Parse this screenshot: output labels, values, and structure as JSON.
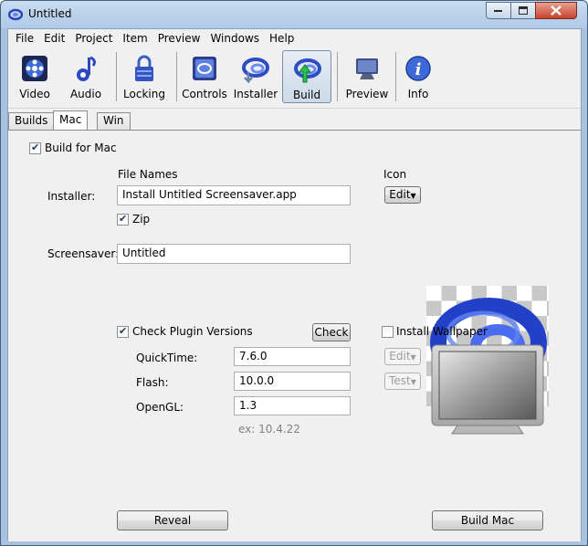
{
  "window": {
    "title": "Untitled"
  },
  "menu": [
    "File",
    "Edit",
    "Project",
    "Item",
    "Preview",
    "Windows",
    "Help"
  ],
  "toolbar": {
    "video": "Video",
    "audio": "Audio",
    "locking": "Locking",
    "controls": "Controls",
    "installer": "Installer",
    "build": "Build",
    "preview": "Preview",
    "info": "Info"
  },
  "tabs": {
    "builds": "Builds",
    "mac": "Mac",
    "win": "Win"
  },
  "form": {
    "build_for_mac": "Build for Mac",
    "file_names": "File Names",
    "icon": "Icon",
    "installer_label": "Installer:",
    "installer_value": "Install Untitled Screensaver.app",
    "edit_icon": "Edit",
    "zip": "Zip",
    "screensaver_label": "Screensaver:",
    "screensaver_value": "Untitled",
    "check_plugins": "Check Plugin Versions",
    "check": "Check",
    "install_wallpaper": "Install Wallpaper",
    "quicktime_label": "QuickTime:",
    "quicktime_value": "7.6.0",
    "flash_label": "Flash:",
    "flash_value": "10.0.0",
    "opengl_label": "OpenGL:",
    "opengl_value": "1.3",
    "example": "ex: 10.4.22",
    "wallpaper_edit": "Edit",
    "wallpaper_test": "Test",
    "reveal": "Reveal",
    "build_mac": "Build Mac"
  },
  "state": {
    "build_for_mac": true,
    "zip": true,
    "check_plugins": true,
    "install_wallpaper": false
  }
}
